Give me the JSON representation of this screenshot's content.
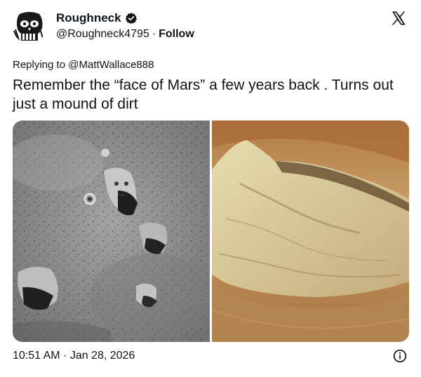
{
  "user": {
    "display_name": "Roughneck",
    "handle": "@Roughneck4795",
    "separator": "·",
    "follow_label": "Follow",
    "verified_badge": "verified-badge-icon"
  },
  "tweet": {
    "replying_to": "Replying to @MattWallace888",
    "text": "Remember the “face of Mars” a few years back .  Turns out just a mound of dirt",
    "timestamp": "10:51 AM · Jan 28, 2026"
  },
  "icons": {
    "brand": "x-logo-icon",
    "info": "info-icon"
  },
  "colors": {
    "text": "#0f1419",
    "mars_left_tone": "#8c8c8c",
    "mars_right_tone": "#b0824f"
  }
}
